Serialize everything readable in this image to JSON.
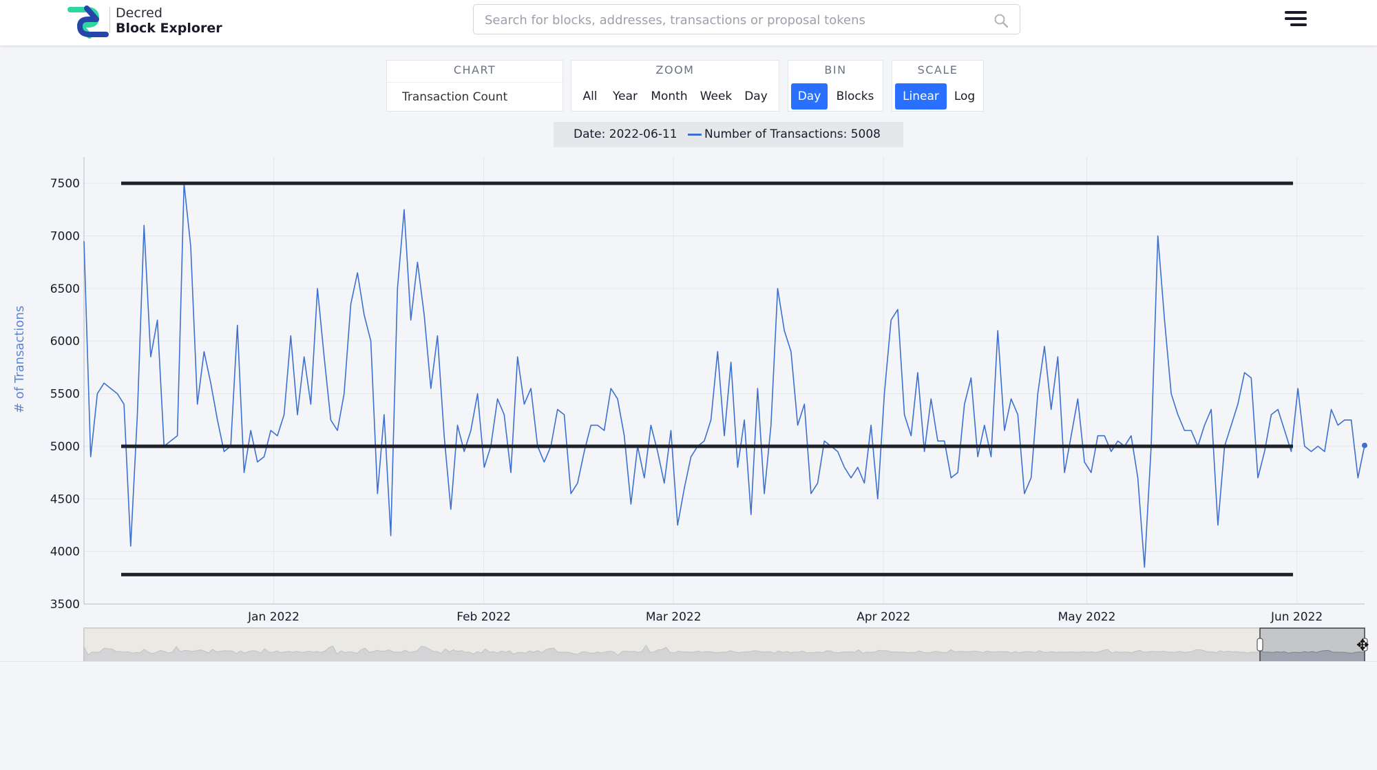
{
  "header": {
    "brand_line1": "Decred",
    "brand_line2": "Block Explorer",
    "search_placeholder": "Search for blocks, addresses, transactions or proposal tokens",
    "brand_colors": {
      "accent": "#2970ff",
      "logo_blue": "#2ed6a1",
      "logo_dark": "#2546a8"
    }
  },
  "controls": {
    "chart": {
      "heading": "CHART",
      "selected": "Transaction Count"
    },
    "zoom": {
      "heading": "ZOOM",
      "options": [
        "All",
        "Year",
        "Month",
        "Week",
        "Day"
      ]
    },
    "bin": {
      "heading": "BIN",
      "options": [
        "Day",
        "Blocks"
      ],
      "active": "Day"
    },
    "scale": {
      "heading": "SCALE",
      "options": [
        "Linear",
        "Log"
      ],
      "active": "Linear"
    }
  },
  "legend": {
    "date": "Date: 2022-06-11",
    "value": "Number of Transactions: 5008"
  },
  "chart_data": {
    "type": "line",
    "ylabel": "# of Transactions",
    "ylim": [
      3500,
      7800
    ],
    "y_ticks": [
      3500,
      4000,
      4500,
      5000,
      5500,
      6000,
      6500,
      7000,
      7500
    ],
    "x_ticks": [
      {
        "label": "Jan 2022",
        "date": "2022-01-01"
      },
      {
        "label": "Feb 2022",
        "date": "2022-02-01"
      },
      {
        "label": "Mar 2022",
        "date": "2022-03-01"
      },
      {
        "label": "Apr 2022",
        "date": "2022-04-01"
      },
      {
        "label": "May 2022",
        "date": "2022-05-01"
      },
      {
        "label": "Jun 2022",
        "date": "2022-06-01"
      }
    ],
    "x_range": [
      "2021-12-04",
      "2022-06-11"
    ],
    "grid": true,
    "series_color": "#3b6fd0",
    "reference_lines": [
      7500,
      5000,
      3780
    ],
    "series": [
      {
        "name": "Number of Transactions",
        "values": [
          6950,
          4900,
          5500,
          5600,
          5550,
          5500,
          5400,
          4050,
          5300,
          7100,
          5850,
          6200,
          5000,
          5050,
          5100,
          7500,
          6900,
          5400,
          5900,
          5600,
          5250,
          4950,
          5000,
          6150,
          4750,
          5150,
          4850,
          4900,
          5150,
          5100,
          5300,
          6050,
          5300,
          5850,
          5400,
          6500,
          5850,
          5250,
          5150,
          5500,
          6350,
          6650,
          6250,
          6000,
          4550,
          5300,
          4150,
          6500,
          7250,
          6200,
          6750,
          6250,
          5550,
          6050,
          5100,
          4400,
          5200,
          4950,
          5150,
          5500,
          4800,
          5000,
          5450,
          5300,
          4750,
          5850,
          5400,
          5550,
          5000,
          4850,
          5000,
          5350,
          5300,
          4550,
          4650,
          4950,
          5200,
          5200,
          5150,
          5550,
          5450,
          5100,
          4450,
          5000,
          4700,
          5200,
          4950,
          4650,
          5150,
          4250,
          4600,
          4900,
          5000,
          5050,
          5250,
          5900,
          5100,
          5800,
          4800,
          5250,
          4350,
          5550,
          4550,
          5200,
          6500,
          6100,
          5900,
          5200,
          5400,
          4550,
          4650,
          5050,
          5000,
          4950,
          4800,
          4700,
          4800,
          4650,
          5200,
          4500,
          5500,
          6200,
          6300,
          5300,
          5100,
          5700,
          4950,
          5450,
          5050,
          5050,
          4700,
          4750,
          5400,
          5650,
          4900,
          5200,
          4900,
          6100,
          5150,
          5450,
          5300,
          4550,
          4700,
          5500,
          5950,
          5350,
          5850,
          4750,
          5100,
          5450,
          4850,
          4750,
          5100,
          5100,
          4950,
          5050,
          5000,
          5100,
          4700,
          3850,
          5000,
          7000,
          6200,
          5500,
          5300,
          5150,
          5150,
          5000,
          5200,
          5350,
          4250,
          5000,
          5200,
          5400,
          5700,
          5650,
          4700,
          4950,
          5300,
          5350,
          5150,
          4950,
          5550,
          5000,
          4950,
          5000,
          4950,
          5350,
          5200,
          5250,
          5250,
          4700,
          5008
        ]
      }
    ]
  }
}
